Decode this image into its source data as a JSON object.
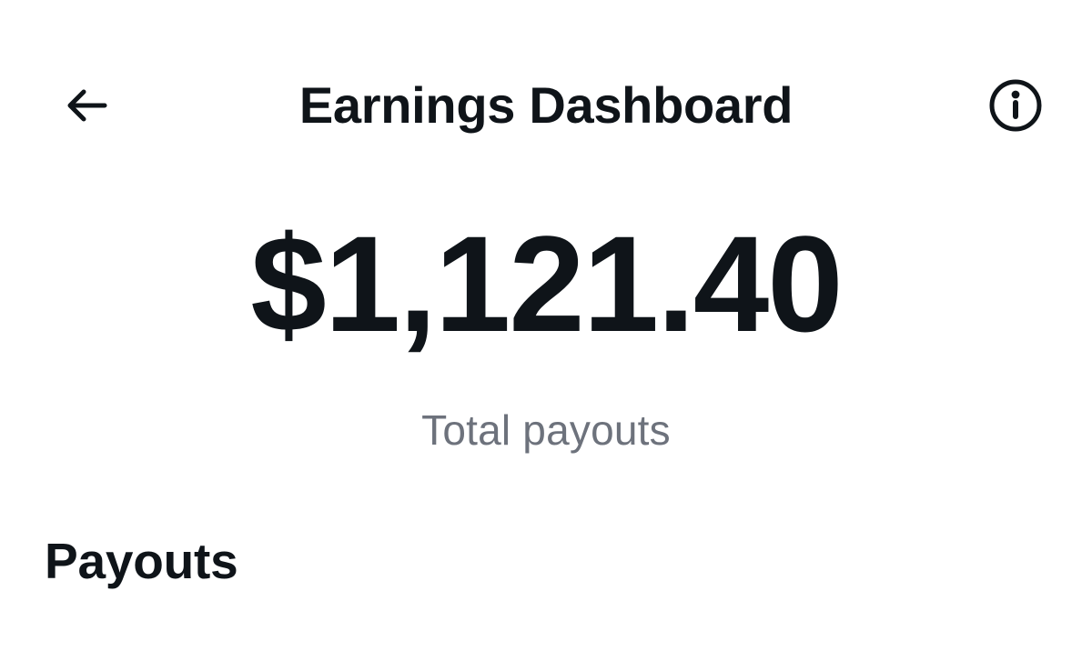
{
  "header": {
    "title": "Earnings Dashboard",
    "back_icon": "arrow-left-icon",
    "info_icon": "info-circle-icon"
  },
  "summary": {
    "total_amount": "$1,121.40",
    "total_label": "Total payouts"
  },
  "section": {
    "title": "Payouts"
  },
  "colors": {
    "text_primary": "#0f1419",
    "text_secondary": "#6d727c",
    "background": "#ffffff"
  }
}
